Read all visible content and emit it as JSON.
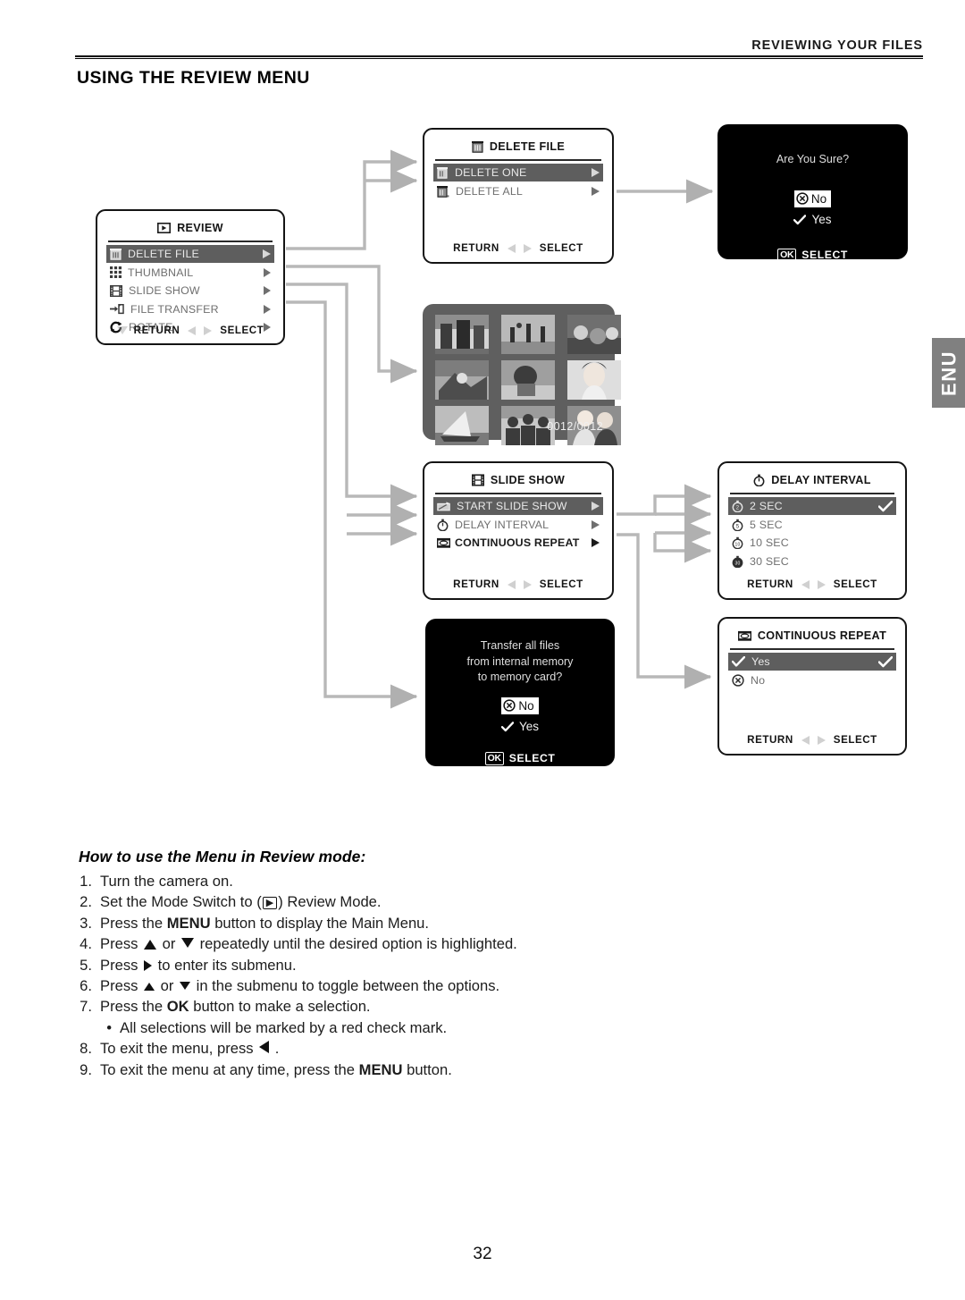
{
  "header": {
    "running_head": "REVIEWING YOUR FILES",
    "title": "USING THE REVIEW MENU"
  },
  "side_tab": {
    "label": "ENU"
  },
  "folio": "32",
  "panels": {
    "review": {
      "title": "REVIEW",
      "title_icon": "play-review-icon",
      "items": [
        {
          "label": "DELETE FILE",
          "icon": "trash-icon",
          "selected": true
        },
        {
          "label": "THUMBNAIL",
          "icon": "grid-icon",
          "selected": false
        },
        {
          "label": "SLIDE SHOW",
          "icon": "film-icon",
          "selected": false
        },
        {
          "label": "FILE TRANSFER",
          "icon": "transfer-icon",
          "selected": false
        },
        {
          "label": "ROTATE",
          "icon": "rotate-icon",
          "selected": false
        }
      ],
      "footer": {
        "return": "RETURN",
        "select": "SELECT"
      }
    },
    "delete_file": {
      "title": "DELETE FILE",
      "title_icon": "trash-icon",
      "items": [
        {
          "label": "DELETE ONE",
          "icon": "trash-one-icon",
          "selected": true
        },
        {
          "label": "DELETE ALL",
          "icon": "trash-all-icon",
          "selected": false
        }
      ],
      "footer": {
        "return": "RETURN",
        "select": "SELECT"
      }
    },
    "slide_show": {
      "title": "SLIDE SHOW",
      "title_icon": "film-icon",
      "items": [
        {
          "label": "START SLIDE SHOW",
          "icon": "projector-icon",
          "selected": true,
          "bold": false
        },
        {
          "label": "DELAY INTERVAL",
          "icon": "stopwatch-icon",
          "selected": false,
          "bold": false
        },
        {
          "label": "CONTINUOUS REPEAT",
          "icon": "repeat-icon",
          "selected": false,
          "bold": true
        }
      ],
      "footer": {
        "return": "RETURN",
        "select": "SELECT"
      }
    },
    "delay_interval": {
      "title": "DELAY INTERVAL",
      "title_icon": "stopwatch-icon",
      "items": [
        {
          "label": "2  SEC",
          "icon": "stopwatch-2-icon",
          "selected": true,
          "checked": true
        },
        {
          "label": "5  SEC",
          "icon": "stopwatch-5-icon",
          "selected": false,
          "checked": false
        },
        {
          "label": "10 SEC",
          "icon": "stopwatch-10-icon",
          "selected": false,
          "checked": false
        },
        {
          "label": "30 SEC",
          "icon": "stopwatch-30-icon",
          "selected": false,
          "checked": false
        }
      ],
      "footer": {
        "return": "RETURN",
        "select": "SELECT"
      }
    },
    "continuous_repeat": {
      "title": "CONTINUOUS REPEAT",
      "title_icon": "repeat-icon",
      "items": [
        {
          "label": "Yes",
          "icon": "check-icon",
          "selected": true,
          "checked": true
        },
        {
          "label": "No",
          "icon": "cross-circle-icon",
          "selected": false,
          "checked": false
        }
      ],
      "footer": {
        "return": "RETURN",
        "select": "SELECT"
      }
    }
  },
  "dialogs": {
    "delete_confirm": {
      "question": "Are You Sure?",
      "option_no": "No",
      "option_yes": "Yes",
      "ok_key": "OK",
      "select": "SELECT"
    },
    "file_transfer": {
      "question_line1": "Transfer all files",
      "question_line2": "from internal memory",
      "question_line3": "to memory card?",
      "option_no": "No",
      "option_yes": "Yes",
      "ok_key": "OK",
      "select": "SELECT"
    }
  },
  "thumbnail_screen": {
    "counter": "0012/0012"
  },
  "howto": {
    "heading": "How to use the Menu in Review mode:",
    "steps": [
      {
        "num": "1.",
        "text": "Turn the camera on."
      },
      {
        "num": "2.",
        "text_before": "Set the Mode Switch to (",
        "key": "▶",
        "text_after": ") Review Mode."
      },
      {
        "num": "3.",
        "text_before": "Press the ",
        "bold": "MENU",
        "text_after": " button to display the Main Menu."
      },
      {
        "num": "4.",
        "text_before": "Press ",
        "text_mid": " or ",
        "text_after": "  repeatedly until the desired option is highlighted."
      },
      {
        "num": "5.",
        "text_before": "Press ",
        "text_after": " to enter its submenu."
      },
      {
        "num": "6.",
        "text_before": "Press ",
        "text_mid": " or ",
        "text_after": " in the submenu to toggle between the options."
      },
      {
        "num": "7.",
        "text_before": "Press the ",
        "bold": "OK",
        "text_after": " button to make a selection."
      },
      {
        "num": "•",
        "text": "All selections will be marked by a red check mark.",
        "sub": true
      },
      {
        "num": "8.",
        "text_before": "To exit the menu, press ",
        "text_after": " ."
      },
      {
        "num": "9.",
        "text_before": "To exit the menu at any time, press the ",
        "bold": "MENU",
        "text_after": " button."
      }
    ]
  },
  "colors": {
    "wire": "#b4b4b4",
    "selected_row": "#5e5e5e",
    "panel_border": "#141414",
    "side_tab": "#808080",
    "lcd_dark": "#000000",
    "thumb_screen": "#5f5f5f"
  }
}
